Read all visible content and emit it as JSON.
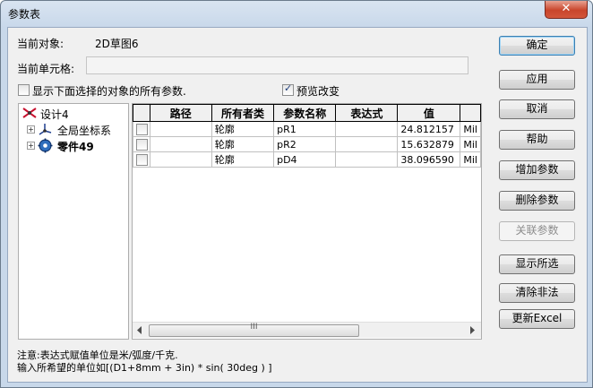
{
  "window": {
    "title": "参数表",
    "close_glyph": "✕"
  },
  "current_object": {
    "label": "当前对象:",
    "value": "2D草图6"
  },
  "current_cell": {
    "label": "当前单元格:",
    "value": ""
  },
  "options": {
    "show_all": {
      "label": "显示下面选择的对象的所有参数.",
      "checked": false
    },
    "preview": {
      "label": "预览改变",
      "checked": true
    }
  },
  "tree": {
    "root": {
      "label": "设计4",
      "icon": "design-icon"
    },
    "children": [
      {
        "label": "全局坐标系",
        "icon": "coordinate-system-icon"
      },
      {
        "label": "零件49",
        "icon": "part-icon",
        "bold": true
      }
    ]
  },
  "grid": {
    "columns": [
      "",
      "路径",
      "所有者类",
      "参数名称",
      "表达式",
      "值",
      ""
    ],
    "rows": [
      {
        "checked": false,
        "path": "",
        "owner": "轮廓",
        "name": "pR1",
        "expr": "",
        "value": "24.812157",
        "unit": "Mil"
      },
      {
        "checked": false,
        "path": "",
        "owner": "轮廓",
        "name": "pR2",
        "expr": "",
        "value": "15.632879",
        "unit": "Mil"
      },
      {
        "checked": false,
        "path": "",
        "owner": "轮廓",
        "name": "pD4",
        "expr": "",
        "value": "38.096590",
        "unit": "Mil"
      }
    ],
    "scroll_grip": "III"
  },
  "buttons": [
    {
      "key": "ok",
      "label": "确定",
      "default": true,
      "enabled": true
    },
    {
      "key": "apply",
      "label": "应用",
      "enabled": true
    },
    {
      "key": "cancel",
      "label": "取消",
      "enabled": true
    },
    {
      "key": "help",
      "label": "帮助",
      "enabled": true
    },
    {
      "key": "add",
      "label": "增加参数",
      "enabled": true
    },
    {
      "key": "delete",
      "label": "删除参数",
      "enabled": true
    },
    {
      "key": "link",
      "label": "关联参数",
      "enabled": false
    },
    {
      "key": "show_selected",
      "label": "显示所选",
      "enabled": true
    },
    {
      "key": "clear_invalid",
      "label": "清除非法",
      "enabled": true
    },
    {
      "key": "update_excel",
      "label": "更新Excel",
      "enabled": true
    }
  ],
  "note": {
    "line1": "注意:表达式赋值单位是米/弧度/千克.",
    "line2": "输入所希望的单位如[(D1+8mm + 3in) * sin( 30deg ) ]"
  }
}
